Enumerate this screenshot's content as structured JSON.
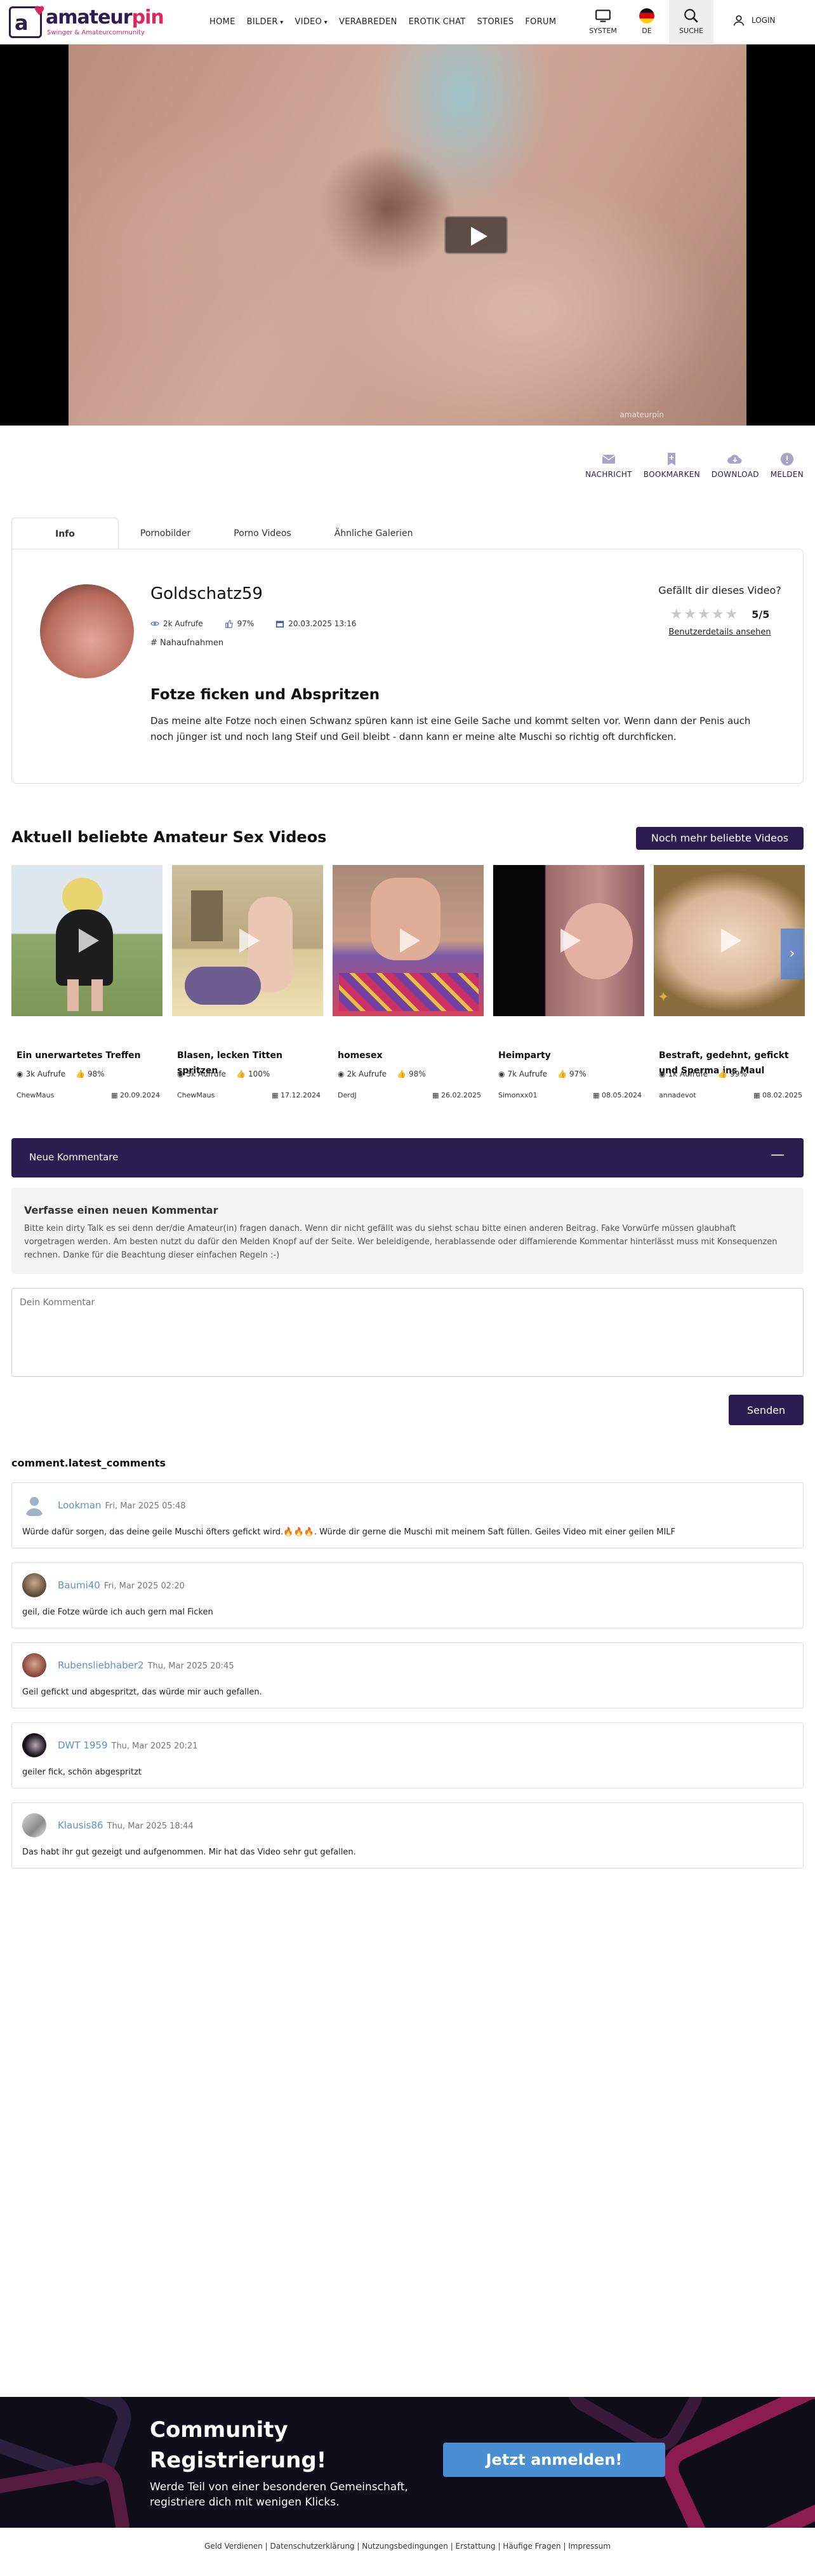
{
  "header": {
    "logo_word_1": "amateur",
    "logo_word_2": "pin",
    "logo_sub": "Swinger & Amateurcommunity",
    "nav": [
      "HOME",
      "BILDER",
      "VIDEO",
      "VERABREDEN",
      "EROTIK CHAT",
      "STORIES",
      "FORUM"
    ],
    "system": "SYSTEM",
    "lang": "DE",
    "search": "SUCHE",
    "login": "LOGIN"
  },
  "video": {
    "watermark": "amateurpin"
  },
  "actions": {
    "message": "NACHRICHT",
    "bookmarks": "BOOKMARKEN",
    "download": "DOWNLOAD",
    "report": "MELDEN"
  },
  "tabs": [
    "Info",
    "Pornobilder",
    "Porno Videos",
    "Ähnliche Galerien"
  ],
  "info": {
    "username": "Goldschatz59",
    "views": "2k Aufrufe",
    "likes": "97%",
    "date": "20.03.2025 13:16",
    "tag": "Nahaufnahmen",
    "title": "Fotze ficken und Abspritzen",
    "description": "Das meine alte Fotze noch einen Schwanz spüren kann ist eine Geile Sache und kommt selten vor. Wenn dann der Penis auch noch jünger ist und noch lang Steif und Geil bleibt - dann kann er meine alte Muschi so richtig oft durchficken.",
    "rating_question": "Gefällt dir dieses Video?",
    "rating_value": "5/5",
    "rating_link": "Benutzerdetails ansehen"
  },
  "popular": {
    "title": "Aktuell beliebte Amateur Sex Videos",
    "more": "Noch mehr beliebte Videos",
    "items": [
      {
        "title": "Ein unerwartetes Treffen",
        "views": "3k Aufrufe",
        "likes": "98%",
        "user": "ChewMaus",
        "date": "20.09.2024"
      },
      {
        "title": "Blasen, lecken Titten spritzen",
        "views": "5k Aufrufe",
        "likes": "100%",
        "user": "ChewMaus",
        "date": "17.12.2024"
      },
      {
        "title": "homesex",
        "views": "2k Aufrufe",
        "likes": "98%",
        "user": "DerdJ",
        "date": "26.02.2025"
      },
      {
        "title": "Heimparty",
        "views": "7k Aufrufe",
        "likes": "97%",
        "user": "Simonxx01",
        "date": "08.05.2024"
      },
      {
        "title": "Bestraft, gedehnt, gefickt und Sperma ins Maul",
        "views": "1k Aufrufe",
        "likes": "99%",
        "user": "annadevot",
        "date": "08.02.2025"
      }
    ]
  },
  "comments": {
    "bar_label": "Neue Kommentare",
    "bar_toggle": "—",
    "notice_title": "Verfasse einen neuen Kommentar",
    "notice_text": "Bitte kein dirty Talk es sei denn der/die Amateur(in) fragen danach. Wenn dir nicht gefällt was du siehst schau bitte einen anderen Beitrag. Fake Vorwürfe müssen glaubhaft vorgetragen werden. Am besten nutzt du dafür den Melden Knopf auf der Seite. Wer beleidigende, herablassende oder diffamierende Kommentar hinterlässt muss mit Konsequenzen rechnen. Danke für die Beachtung dieser einfachen Regeln :-)",
    "placeholder": "Dein Kommentar",
    "send": "Senden",
    "latest_title": "comment.latest_comments",
    "list": [
      {
        "name": "Lookman",
        "date": "Fri, Mar 2025 05:48",
        "text": "Würde dafür sorgen, das deine geile Muschi öfters gefickt wird.🔥🔥🔥. Würde dir gerne die Muschi mit meinem Saft füllen. Geiles Video mit einer geilen MILF"
      },
      {
        "name": "Baumi40",
        "date": "Fri, Mar 2025 02:20",
        "text": "geil, die Fotze würde ich auch gern mal Ficken"
      },
      {
        "name": "Rubensliebhaber2",
        "date": "Thu, Mar 2025 20:45",
        "text": "Geil gefickt und abgespritzt, das würde mir auch gefallen."
      },
      {
        "name": "DWT 1959",
        "date": "Thu, Mar 2025 20:21",
        "text": "geiler fick, schön abgespritzt"
      },
      {
        "name": "Klausis86",
        "date": "Thu, Mar 2025 18:44",
        "text": "Das habt ihr gut gezeigt und aufgenommen. Mir hat das Video sehr gut gefallen."
      }
    ]
  },
  "cta": {
    "line1": "Community",
    "line2": "Registrierung!",
    "sub1": "Werde Teil von einer besonderen Gemeinschaft,",
    "sub2": "registriere dich mit wenigen Klicks.",
    "button": "Jetzt anmelden!"
  },
  "footer": {
    "links": [
      "Geld Verdienen",
      "Datenschutzerklärung",
      "Nutzungsbedingungen",
      "Erstattung",
      "Häufige Fragen",
      "Impressum"
    ]
  },
  "colors": {
    "brand_dark": "#2b1d4f",
    "brand_pink": "#e0245e",
    "link_blue": "#5a93c6",
    "cta_button": "#4a8fd4"
  }
}
